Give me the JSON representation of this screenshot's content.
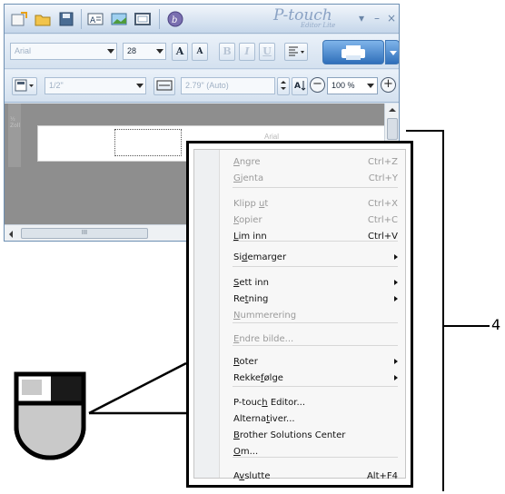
{
  "app": {
    "logo_main": "P-touch",
    "logo_sub": "Editor Lite",
    "window_controls": [
      "▾",
      "–",
      "×"
    ]
  },
  "toolbar": {
    "font_name": "Arial",
    "font_size": "28",
    "grow_font_label": "A",
    "shrink_font_label": "A",
    "bold_label": "B",
    "italic_label": "I",
    "underline_label": "U",
    "tape_width": "1/2\"",
    "tape_length": "2.79\" (Auto)",
    "zoom_value": "100 %",
    "zoom_out_label": "−",
    "zoom_in_label": "+"
  },
  "canvas": {
    "ruler_text": "½ Zoll",
    "ghost_text": "Arial",
    "hscroll_grip": "III"
  },
  "context_menu": {
    "items": [
      {
        "pre": "",
        "key": "A",
        "post": "ngre",
        "shortcut": "Ctrl+Z",
        "disabled": true,
        "submenu": false
      },
      {
        "pre": "",
        "key": "G",
        "post": "jenta",
        "shortcut": "Ctrl+Y",
        "disabled": true,
        "submenu": false
      },
      {
        "pre": "Klipp ",
        "key": "u",
        "post": "t",
        "shortcut": "Ctrl+X",
        "disabled": true,
        "submenu": false
      },
      {
        "pre": "",
        "key": "K",
        "post": "opier",
        "shortcut": "Ctrl+C",
        "disabled": true,
        "submenu": false
      },
      {
        "pre": "",
        "key": "L",
        "post": "im inn",
        "shortcut": "Ctrl+V",
        "disabled": false,
        "submenu": false
      },
      {
        "pre": "Si",
        "key": "d",
        "post": "emarger",
        "shortcut": "",
        "disabled": false,
        "submenu": true
      },
      {
        "pre": "",
        "key": "S",
        "post": "ett inn",
        "shortcut": "",
        "disabled": false,
        "submenu": true
      },
      {
        "pre": "Re",
        "key": "t",
        "post": "ning",
        "shortcut": "",
        "disabled": false,
        "submenu": true
      },
      {
        "pre": "",
        "key": "N",
        "post": "ummerering",
        "shortcut": "",
        "disabled": true,
        "submenu": false
      },
      {
        "pre": "",
        "key": "E",
        "post": "ndre bilde...",
        "shortcut": "",
        "disabled": true,
        "submenu": false
      },
      {
        "pre": "",
        "key": "R",
        "post": "oter",
        "shortcut": "",
        "disabled": false,
        "submenu": true
      },
      {
        "pre": "Rekke",
        "key": "f",
        "post": "ølge",
        "shortcut": "",
        "disabled": false,
        "submenu": true
      },
      {
        "pre": "P-touc",
        "key": "h",
        "post": " Editor...",
        "shortcut": "",
        "disabled": false,
        "submenu": false
      },
      {
        "pre": "Alterna",
        "key": "t",
        "post": "iver...",
        "shortcut": "",
        "disabled": false,
        "submenu": false
      },
      {
        "pre": "",
        "key": "B",
        "post": "rother Solutions Center",
        "shortcut": "",
        "disabled": false,
        "submenu": false
      },
      {
        "pre": "",
        "key": "O",
        "post": "m...",
        "shortcut": "",
        "disabled": false,
        "submenu": false
      },
      {
        "pre": "A",
        "key": "v",
        "post": "slutte",
        "shortcut": "Alt+F4",
        "disabled": false,
        "submenu": false
      }
    ]
  },
  "callout": {
    "number": "4"
  },
  "colors": {
    "window_border": "#6d8fb3",
    "print_button": "#2f6fba",
    "disabled_text": "#9a9a9a",
    "mouse_left_button": "#c9c9c9"
  },
  "icons": {
    "quick_access": [
      "new-file-icon",
      "open-folder-icon",
      "save-icon",
      "text-icon",
      "image-icon",
      "frame-icon",
      "brother-logo-icon"
    ],
    "mouse": "mouse-right-click-icon"
  }
}
